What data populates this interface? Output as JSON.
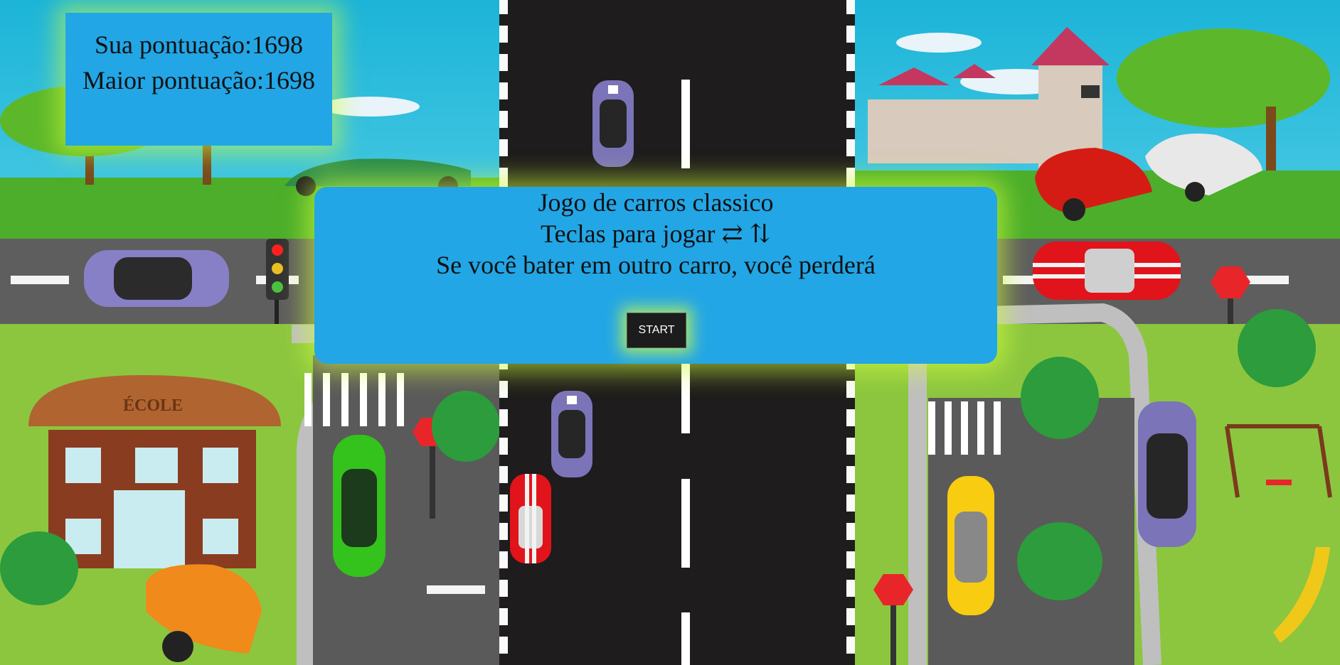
{
  "score": {
    "current_label": "Sua pontuação:1698",
    "high_label": "Maior pontuação:1698"
  },
  "intro_panel": {
    "title": "Jogo de carros classico",
    "controls": "Teclas para jogar ⇄ ⇅",
    "warning": "Se você bater em outro carro, você perderá",
    "start_button": "START"
  },
  "scenery": {
    "left_sign": "ÉCOLE"
  },
  "colors": {
    "panel": "#22a6e6",
    "glow": "#d2ff3c",
    "road": "#1e1c1c",
    "player_car": "#e0141a",
    "enemy_car": "#7b74b8"
  }
}
